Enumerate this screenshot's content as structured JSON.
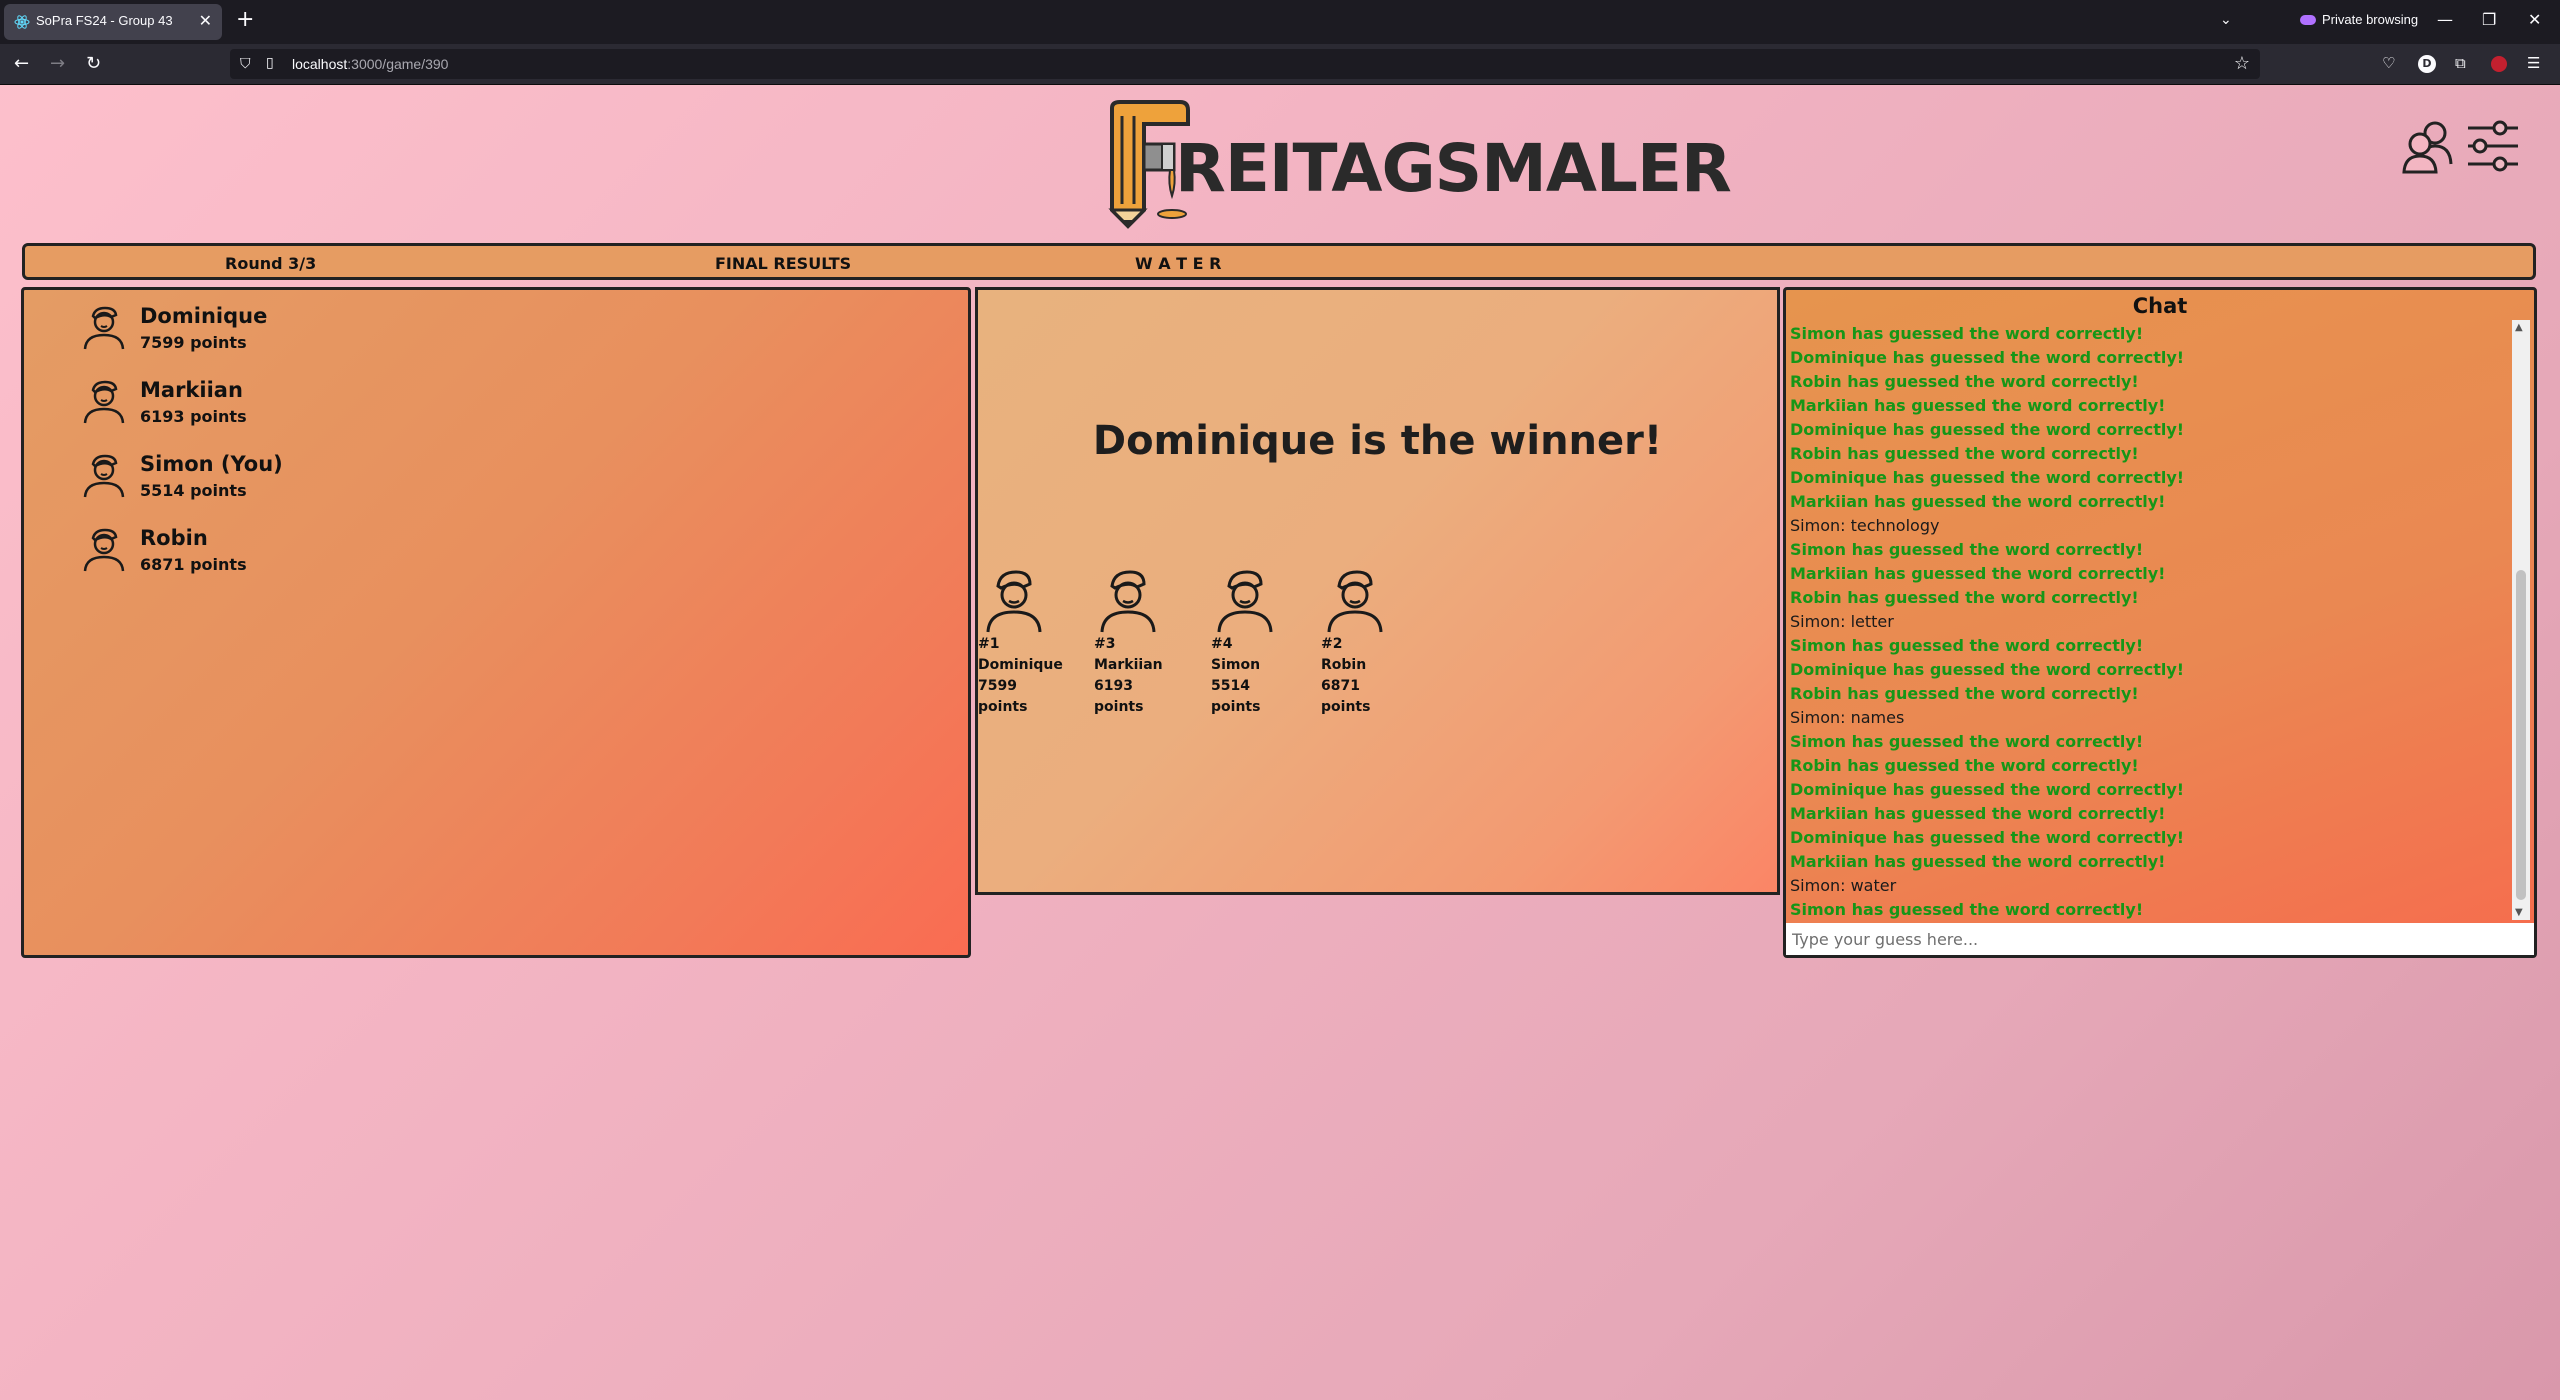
{
  "browser": {
    "tab_title": "SoPra FS24 - Group 43",
    "tab_close": "✕",
    "new_tab": "+",
    "tab_list": "⌄",
    "private_label": "Private browsing",
    "url_host": "localhost",
    "url_path": ":3000/game/390",
    "window_controls": [
      "—",
      "❐",
      "✕"
    ]
  },
  "app": {
    "logo_text": "REITAGSMALER",
    "info": {
      "round": "Round 3/3",
      "phase": "FINAL RESULTS",
      "word": "W A T E R"
    }
  },
  "players": [
    {
      "name": "Dominique",
      "points": "7599 points"
    },
    {
      "name": "Markiian",
      "points": "6193 points"
    },
    {
      "name": "Simon (You)",
      "points": "5514 points"
    },
    {
      "name": "Robin",
      "points": "6871 points"
    }
  ],
  "results": {
    "winner_text": "Dominique is the winner!",
    "podium": [
      {
        "rank": "#1",
        "name": "Dominique",
        "score": "7599",
        "unit": "points"
      },
      {
        "rank": "#3",
        "name": "Markiian",
        "score": "6193",
        "unit": "points"
      },
      {
        "rank": "#4",
        "name": "Simon",
        "score": "5514",
        "unit": "points"
      },
      {
        "rank": "#2",
        "name": "Robin",
        "score": "6871",
        "unit": "points"
      }
    ]
  },
  "chat": {
    "title": "Chat",
    "placeholder": "Type your guess here...",
    "messages": [
      {
        "text": "Simon has guessed the word correctly!",
        "correct": true
      },
      {
        "text": "Dominique has guessed the word correctly!",
        "correct": true
      },
      {
        "text": "Robin has guessed the word correctly!",
        "correct": true
      },
      {
        "text": "Markiian has guessed the word correctly!",
        "correct": true
      },
      {
        "text": "Dominique has guessed the word correctly!",
        "correct": true
      },
      {
        "text": "Robin has guessed the word correctly!",
        "correct": true
      },
      {
        "text": "Dominique has guessed the word correctly!",
        "correct": true
      },
      {
        "text": "Markiian has guessed the word correctly!",
        "correct": true
      },
      {
        "text": "Simon: technology",
        "correct": false
      },
      {
        "text": "Simon has guessed the word correctly!",
        "correct": true
      },
      {
        "text": "Markiian has guessed the word correctly!",
        "correct": true
      },
      {
        "text": "Robin has guessed the word correctly!",
        "correct": true
      },
      {
        "text": "Simon: letter",
        "correct": false
      },
      {
        "text": "Simon has guessed the word correctly!",
        "correct": true
      },
      {
        "text": "Dominique has guessed the word correctly!",
        "correct": true
      },
      {
        "text": "Robin has guessed the word correctly!",
        "correct": true
      },
      {
        "text": "Simon: names",
        "correct": false
      },
      {
        "text": "Simon has guessed the word correctly!",
        "correct": true
      },
      {
        "text": "Robin has guessed the word correctly!",
        "correct": true
      },
      {
        "text": "Dominique has guessed the word correctly!",
        "correct": true
      },
      {
        "text": "Markiian has guessed the word correctly!",
        "correct": true
      },
      {
        "text": "Dominique has guessed the word correctly!",
        "correct": true
      },
      {
        "text": "Markiian has guessed the word correctly!",
        "correct": true
      },
      {
        "text": "Simon: water",
        "correct": false
      },
      {
        "text": "Simon has guessed the word correctly!",
        "correct": true
      }
    ]
  },
  "colors": {
    "correct_guess": "#169617",
    "panel_border": "#222222",
    "info_bar": "#e69c62"
  }
}
